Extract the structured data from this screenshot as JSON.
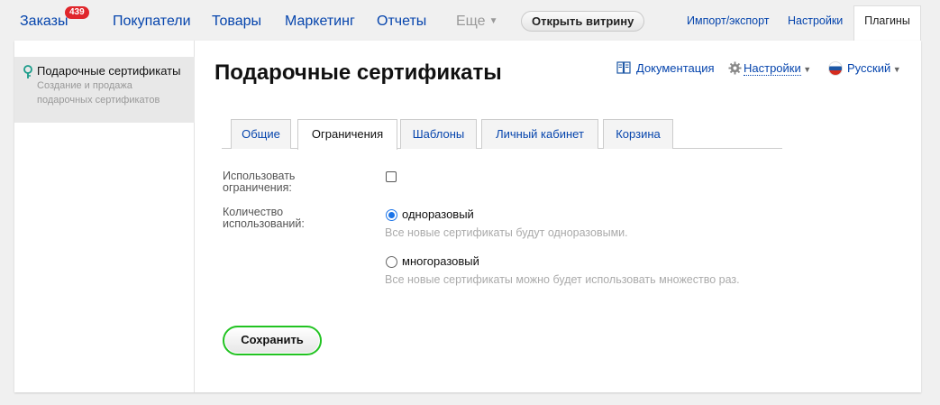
{
  "nav": {
    "orders": "Заказы",
    "orders_badge": "439",
    "customers": "Покупатели",
    "products": "Товары",
    "marketing": "Маркетинг",
    "reports": "Отчеты",
    "more": "Еще",
    "open_storefront": "Открыть витрину",
    "import_export": "Импорт/экспорт",
    "settings": "Настройки",
    "plugins": "Плагины"
  },
  "sidebar": {
    "items": [
      {
        "title": "Подарочные сертификаты",
        "description": "Создание и продажа подарочных сертификатов"
      }
    ]
  },
  "page": {
    "title": "Подарочные сертификаты",
    "documentation": "Документация",
    "settings": "Настройки",
    "language": "Русский"
  },
  "tabs": [
    {
      "label": "Общие",
      "active": false
    },
    {
      "label": "Ограничения",
      "active": true
    },
    {
      "label": "Шаблоны",
      "active": false
    },
    {
      "label": "Личный кабинет",
      "active": false
    },
    {
      "label": "Корзина",
      "active": false
    }
  ],
  "form": {
    "use_restrictions_label": "Использовать ограничения:",
    "use_restrictions_checked": false,
    "usage_count_label": "Количество использований:",
    "options": [
      {
        "label": "одноразовый",
        "hint": "Все новые сертификаты будут одноразовыми.",
        "checked": true
      },
      {
        "label": "многоразовый",
        "hint": "Все новые сертификаты можно будет использовать множество раз.",
        "checked": false
      }
    ],
    "save_label": "Сохранить"
  },
  "colors": {
    "link": "#0645ad",
    "badge": "#e0262b",
    "save_border": "#22c322",
    "radio_accent": "#1a73e8"
  }
}
